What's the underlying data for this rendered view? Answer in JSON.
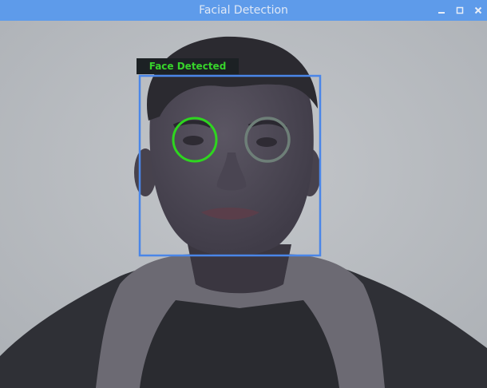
{
  "window": {
    "title": "Facial Detection",
    "titlebar_color": "#5e9bea",
    "controls": [
      "minimize-icon",
      "maximize-icon",
      "close-icon"
    ]
  },
  "detection": {
    "label": "Face Detected",
    "label_color": "#37d42b",
    "face_box_color": "#4a86e8",
    "eye_detected_color": "#2ed61f",
    "eye_secondary_color": "#6e7f78"
  }
}
